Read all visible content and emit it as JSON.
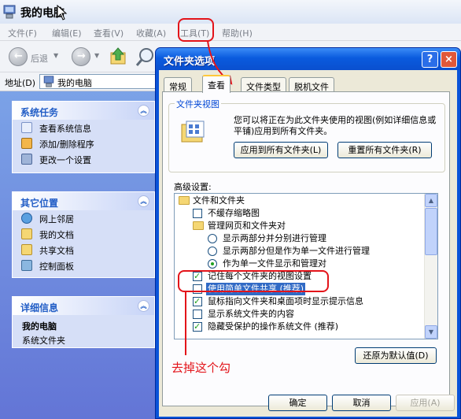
{
  "window": {
    "title": "我的电脑"
  },
  "menu": [
    "文件(F)",
    "编辑(E)",
    "查看(V)",
    "收藏(A)",
    "工具(T)",
    "帮助(H)"
  ],
  "toolbar": {
    "back_label": "后退"
  },
  "address": {
    "label": "地址(D)",
    "value": "我的电脑"
  },
  "left_panels": {
    "system_tasks": {
      "title": "系统任务",
      "items": [
        "查看系统信息",
        "添加/删除程序",
        "更改一个设置"
      ]
    },
    "other_places": {
      "title": "其它位置",
      "items": [
        "网上邻居",
        "我的文档",
        "共享文档",
        "控制面板"
      ]
    },
    "details": {
      "title": "详细信息",
      "name": "我的电脑",
      "type": "系统文件夹"
    }
  },
  "dialog": {
    "title": "文件夹选项",
    "help_btn": "?",
    "close_btn": "×",
    "tabs": [
      "常规",
      "查看",
      "文件类型",
      "脱机文件"
    ],
    "folder_views": {
      "label": "文件夹视图",
      "description": "您可以将正在为此文件夹使用的视图(例如详细信息或平铺)应用到所有文件夹。",
      "apply_all": "应用到所有文件夹(L)",
      "reset_all": "重置所有文件夹(R)"
    },
    "advanced_label": "高级设置:",
    "tree": [
      "文件和文件夹",
      "不缓存缩略图",
      "管理网页和文件夹对",
      "显示两部分并分别进行管理",
      "显示两部分但是作为单一文件进行管理",
      "作为单一文件显示和管理对",
      "记住每个文件夹的视图设置",
      "使用简单文件共享 (推荐)",
      "鼠标指向文件夹和桌面项时显示提示信息",
      "显示系统文件夹的内容",
      "隐藏受保护的操作系统文件 (推荐)"
    ],
    "restore_defaults": "还原为默认值(D)",
    "ok": "确定",
    "cancel": "取消",
    "apply": "应用(A)"
  },
  "annotation": "去掉这个勾"
}
